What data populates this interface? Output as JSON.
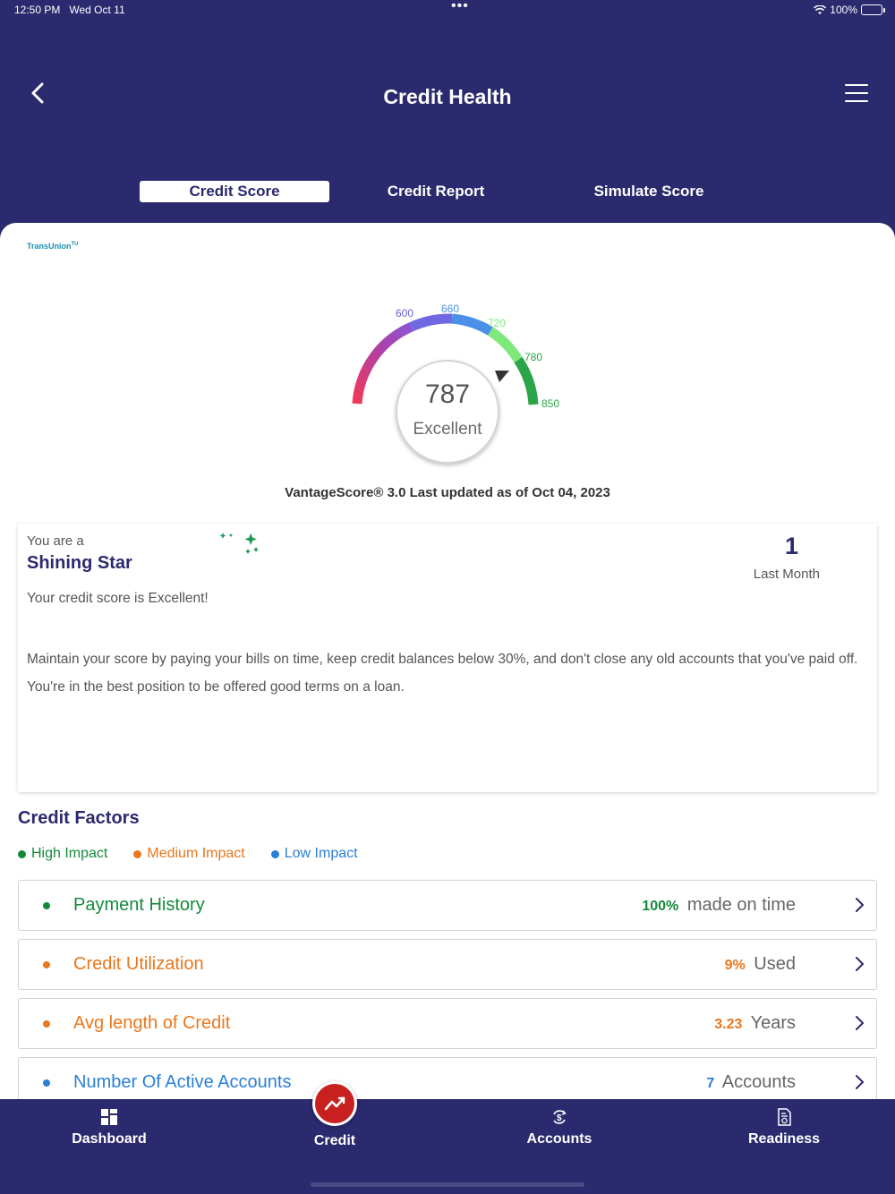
{
  "status_bar": {
    "time": "12:50 PM",
    "date": "Wed Oct 11",
    "battery": "100%",
    "more": "•••"
  },
  "header": {
    "title": "Credit Health"
  },
  "tabs": [
    {
      "label": "Credit Score",
      "active": true
    },
    {
      "label": "Credit Report",
      "active": false
    },
    {
      "label": "Simulate Score",
      "active": false
    }
  ],
  "bureau": {
    "name": "TransUnion"
  },
  "gauge": {
    "ticks": [
      "600",
      "660",
      "720",
      "780",
      "850"
    ],
    "score": "787",
    "rating": "Excellent",
    "score_value": 787,
    "min": 300,
    "max": 850
  },
  "updated_text": "VantageScore® 3.0 Last updated as of Oct 04, 2023",
  "summary_card": {
    "prefix": "You are a",
    "title": "Shining Star",
    "count": "1",
    "count_label": "Last Month",
    "message": "Your credit score is Excellent!",
    "advice": "Maintain your score by paying your bills on time, keep credit balances below 30%, and don't close any old accounts that you've paid off. You're in the best position to be offered good terms on a loan."
  },
  "credit_factors": {
    "title": "Credit Factors",
    "legend": [
      {
        "label": "High Impact",
        "color": "#138a3b"
      },
      {
        "label": "Medium Impact",
        "color": "#e8771e"
      },
      {
        "label": "Low Impact",
        "color": "#2b7fd8"
      }
    ],
    "items": [
      {
        "name": "Payment History",
        "value": "100%",
        "suffix": "made on time",
        "color": "#138a3b"
      },
      {
        "name": "Credit Utilization",
        "value": "9%",
        "suffix": "Used",
        "color": "#e8771e"
      },
      {
        "name": "Avg length of Credit",
        "value": "3.23",
        "suffix": "Years",
        "color": "#e8771e"
      },
      {
        "name": "Number Of Active Accounts",
        "value": "7",
        "suffix": "Accounts",
        "color": "#2b7fd8"
      }
    ]
  },
  "bottom_nav": [
    {
      "label": "Dashboard",
      "icon": "dashboard-grid-icon"
    },
    {
      "label": "Credit",
      "icon": "trend-up-icon",
      "active": true
    },
    {
      "label": "Accounts",
      "icon": "dollar-cycle-icon"
    },
    {
      "label": "Readiness",
      "icon": "document-icon"
    }
  ],
  "colors": {
    "brand": "#2b2a6e",
    "credit_active": "#c8201e"
  }
}
